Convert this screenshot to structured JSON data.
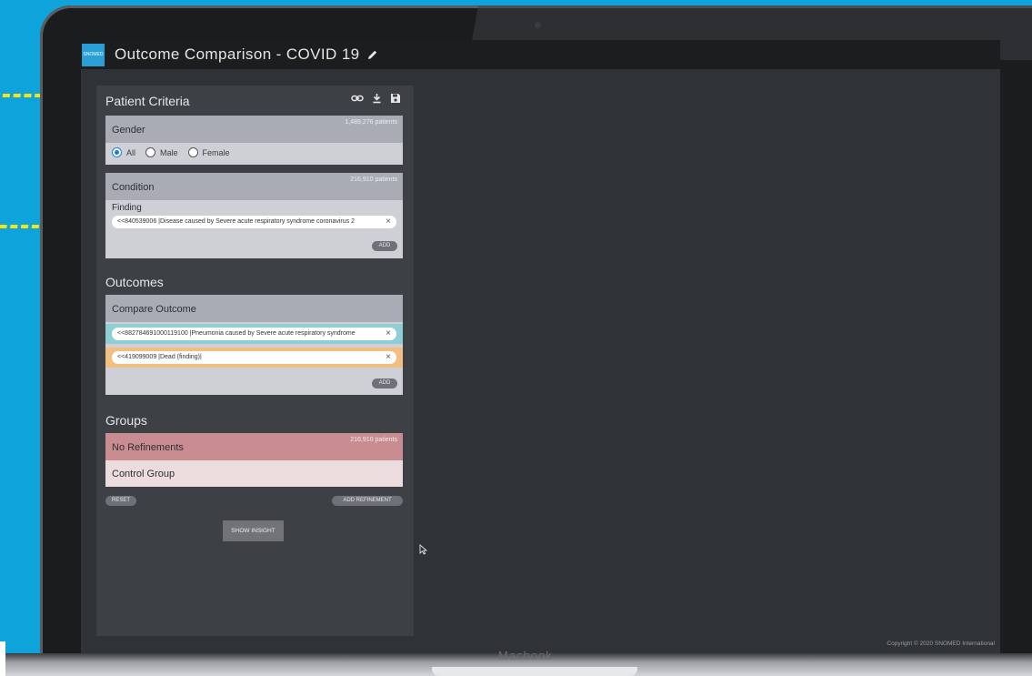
{
  "app": {
    "logo_text": "SNOMED",
    "title": "Outcome Comparison - COVID 19",
    "copyright": "Copyright © 2020 SNOMED International"
  },
  "device": {
    "brand": "Macbook"
  },
  "criteria": {
    "title": "Patient Criteria",
    "icons": [
      "link-icon",
      "download-icon",
      "save-icon"
    ],
    "gender": {
      "label": "Gender",
      "count": "1,489,276 patients",
      "options": [
        "All",
        "Male",
        "Female"
      ],
      "selected": "All"
    },
    "condition": {
      "label": "Condition",
      "count": "216,910 patients",
      "field_label": "Finding",
      "value": "<<840539006 |Disease caused by Severe acute respiratory syndrome coronavirus 2",
      "add_label": "ADD"
    }
  },
  "outcomes": {
    "title": "Outcomes",
    "card_label": "Compare Outcome",
    "items": [
      {
        "value": "<<882784691000119100 |Pneumonia caused by Severe acute respiratory syndrome",
        "color": "#8fcfd3"
      },
      {
        "value": "<<419099009 |Dead (finding)|",
        "color": "#f2bf83"
      }
    ],
    "add_label": "ADD"
  },
  "groups": {
    "title": "Groups",
    "no_refinements_label": "No Refinements",
    "count": "216,910 patients",
    "control_label": "Control Group",
    "header_color": "#c98c91",
    "body_color": "#ecdcdd",
    "reset_label": "RESET",
    "add_refinement_label": "ADD REFINEMENT"
  },
  "actions": {
    "show_insight_label": "SHOW INSIGHT"
  }
}
